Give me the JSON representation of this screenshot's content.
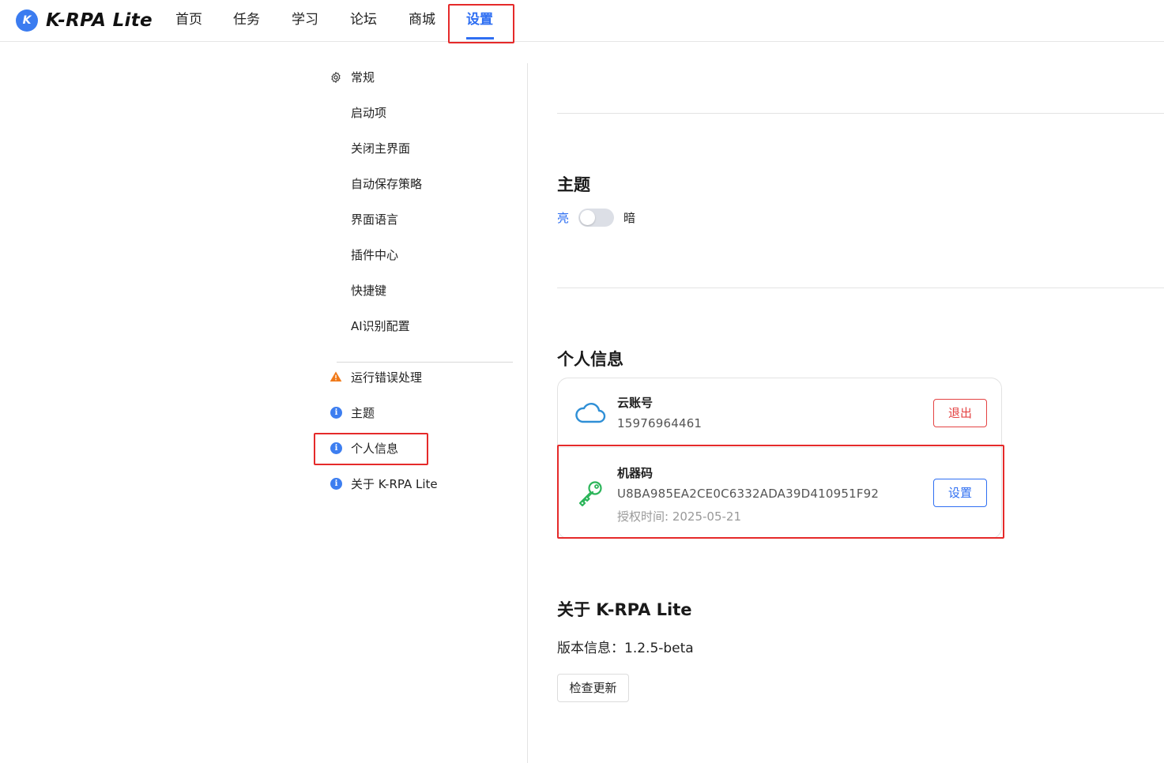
{
  "app": {
    "logo_letter": "K",
    "name": "K-RPA Lite"
  },
  "nav": {
    "items": [
      {
        "label": "首页"
      },
      {
        "label": "任务"
      },
      {
        "label": "学习"
      },
      {
        "label": "论坛"
      },
      {
        "label": "商城"
      },
      {
        "label": "设置",
        "active": true
      }
    ]
  },
  "sidebar": {
    "general": {
      "label": "常规",
      "icon": "gear-icon"
    },
    "sub_items": [
      {
        "label": "启动项"
      },
      {
        "label": "关闭主界面"
      },
      {
        "label": "自动保存策略"
      },
      {
        "label": "界面语言"
      },
      {
        "label": "插件中心"
      },
      {
        "label": "快捷键"
      },
      {
        "label": "AI识别配置"
      }
    ],
    "other_items": [
      {
        "label": "运行错误处理",
        "icon": "warning-icon"
      },
      {
        "label": "主题",
        "icon": "info-icon"
      },
      {
        "label": "个人信息",
        "icon": "info-icon",
        "highlighted": true
      },
      {
        "label": "关于 K-RPA Lite",
        "icon": "info-icon"
      }
    ]
  },
  "theme": {
    "title": "主题",
    "light_label": "亮",
    "dark_label": "暗",
    "is_dark": false
  },
  "profile": {
    "title": "个人信息",
    "cloud_account": {
      "title": "云账号",
      "value": "15976964461",
      "icon": "cloud-icon",
      "button": "退出"
    },
    "machine_code": {
      "title": "机器码",
      "value": "U8BA985EA2CE0C6332ADA39D410951F92",
      "auth_time": "授权时间: 2025-05-21",
      "icon": "key-icon",
      "button": "设置"
    }
  },
  "about": {
    "title": "关于 K-RPA Lite",
    "version_text": "版本信息：1.2.5-beta",
    "check_button": "检查更新"
  },
  "colors": {
    "accent": "#2f6ff2",
    "danger": "#e44343",
    "highlight_box": "#e52a2a",
    "warning": "#f07a1a",
    "key_green": "#2cb55a",
    "cloud_blue": "#2f8fd6"
  }
}
